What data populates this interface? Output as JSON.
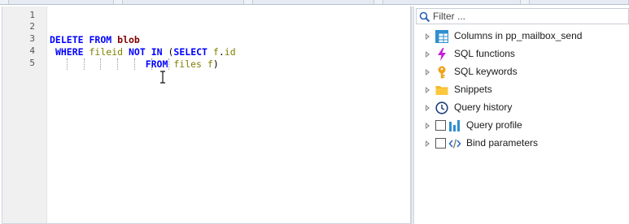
{
  "editor": {
    "line_numbers": [
      "1",
      "2",
      "3",
      "4",
      "5"
    ],
    "lines": {
      "l3": [
        {
          "t": "DELETE",
          "c": "kw"
        },
        {
          "t": " ",
          "c": "plain"
        },
        {
          "t": "FROM",
          "c": "kw"
        },
        {
          "t": " ",
          "c": "plain"
        },
        {
          "t": "blob",
          "c": "tbl"
        }
      ],
      "l4": [
        {
          "t": " ",
          "c": "plain"
        },
        {
          "t": "WHERE",
          "c": "kw"
        },
        {
          "t": " ",
          "c": "plain"
        },
        {
          "t": "fileid",
          "c": "col"
        },
        {
          "t": " ",
          "c": "plain"
        },
        {
          "t": "NOT",
          "c": "kw"
        },
        {
          "t": " ",
          "c": "plain"
        },
        {
          "t": "IN",
          "c": "kw"
        },
        {
          "t": " (",
          "c": "plain"
        },
        {
          "t": "SELECT",
          "c": "kw"
        },
        {
          "t": " ",
          "c": "plain"
        },
        {
          "t": "f",
          "c": "col"
        },
        {
          "t": ".",
          "c": "plain"
        },
        {
          "t": "id",
          "c": "col"
        }
      ],
      "l5": [
        {
          "t": "                 ",
          "c": "plain"
        },
        {
          "t": "FROM",
          "c": "kw"
        },
        {
          "t": " ",
          "c": "plain"
        },
        {
          "t": "files",
          "c": "col"
        },
        {
          "t": " ",
          "c": "plain"
        },
        {
          "t": "f",
          "c": "col"
        },
        {
          "t": ")",
          "c": "plain"
        }
      ]
    }
  },
  "filter": {
    "placeholder": "Filter ...",
    "value": ""
  },
  "tree": {
    "items": [
      {
        "label": "Columns in pp_mailbox_send",
        "icon": "table-columns-icon",
        "checkbox": false
      },
      {
        "label": "SQL functions",
        "icon": "function-lightning-icon",
        "checkbox": false
      },
      {
        "label": "SQL keywords",
        "icon": "key-icon",
        "checkbox": false
      },
      {
        "label": "Snippets",
        "icon": "folder-icon",
        "checkbox": false
      },
      {
        "label": "Query history",
        "icon": "clock-history-icon",
        "checkbox": false
      },
      {
        "label": "Query profile",
        "icon": "bar-chart-icon",
        "checkbox": true,
        "checked": false
      },
      {
        "label": "Bind parameters",
        "icon": "code-brackets-icon",
        "checkbox": true,
        "checked": false
      }
    ]
  },
  "colors": {
    "keyword": "#0000ff",
    "table": "#800000",
    "identifier": "#808000"
  }
}
